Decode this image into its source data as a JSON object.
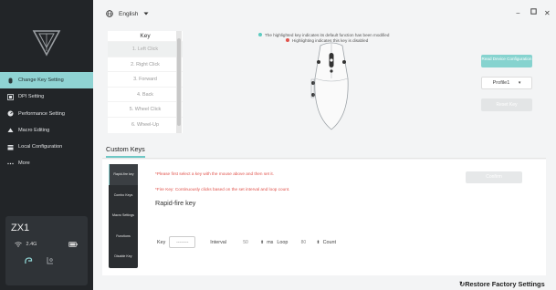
{
  "sidebar": {
    "nav": [
      {
        "label": "Change Key Setting",
        "icon": "mouse-icon",
        "active": true
      },
      {
        "label": "DPI Setting",
        "icon": "dpi-icon",
        "active": false
      },
      {
        "label": "Performance Setting",
        "icon": "gauge-icon",
        "active": false
      },
      {
        "label": "Macro Editing",
        "icon": "keyboard-icon",
        "active": false
      },
      {
        "label": "Local Configuration",
        "icon": "config-icon",
        "active": false
      },
      {
        "label": "More",
        "icon": "more-icon",
        "active": false
      }
    ],
    "device": {
      "name": "ZX1",
      "connection": "2.4G",
      "battery_icon": "battery-icon"
    }
  },
  "topbar": {
    "language": "English"
  },
  "keys": {
    "header": "Key",
    "items": [
      "1. Left Click",
      "2. Right Click",
      "3. Forward",
      "4. Back",
      "5. Wheel Click",
      "6. Wheel-Up"
    ]
  },
  "legend": {
    "modified": "The highlighted key indicates its default function has been modified",
    "disabled": "Highlighting indicates this key is disabled",
    "modified_color": "#5ccbc0",
    "disabled_color": "#e0524b"
  },
  "right": {
    "read_config": "Read Device Configuration",
    "profile": "Profile1",
    "reset": "Reset Key"
  },
  "tabs": {
    "custom": "Custom Keys"
  },
  "submenu": [
    "Rapid-fire key",
    "Combo Keys",
    "Macro Settings",
    "Functions",
    "Disable Key"
  ],
  "content": {
    "note1": "*Please first select a key with the mouse above and then set it.",
    "note2": "*Fire Key: Continuously clicks based on the set interval and loop count.",
    "title": "Rapid-fire key",
    "confirm": "Confirm",
    "key_label": "Key",
    "key_value": "--------",
    "interval_label": "Interval",
    "interval_value": "50",
    "ms_label": "ms",
    "loop_label": "Loop",
    "loop_value": "80",
    "count_label": "Count"
  },
  "footer": {
    "restore": "Restore Factory Settings"
  },
  "colors": {
    "accent": "#8fd3d3",
    "sidebar_bg": "#222528"
  }
}
